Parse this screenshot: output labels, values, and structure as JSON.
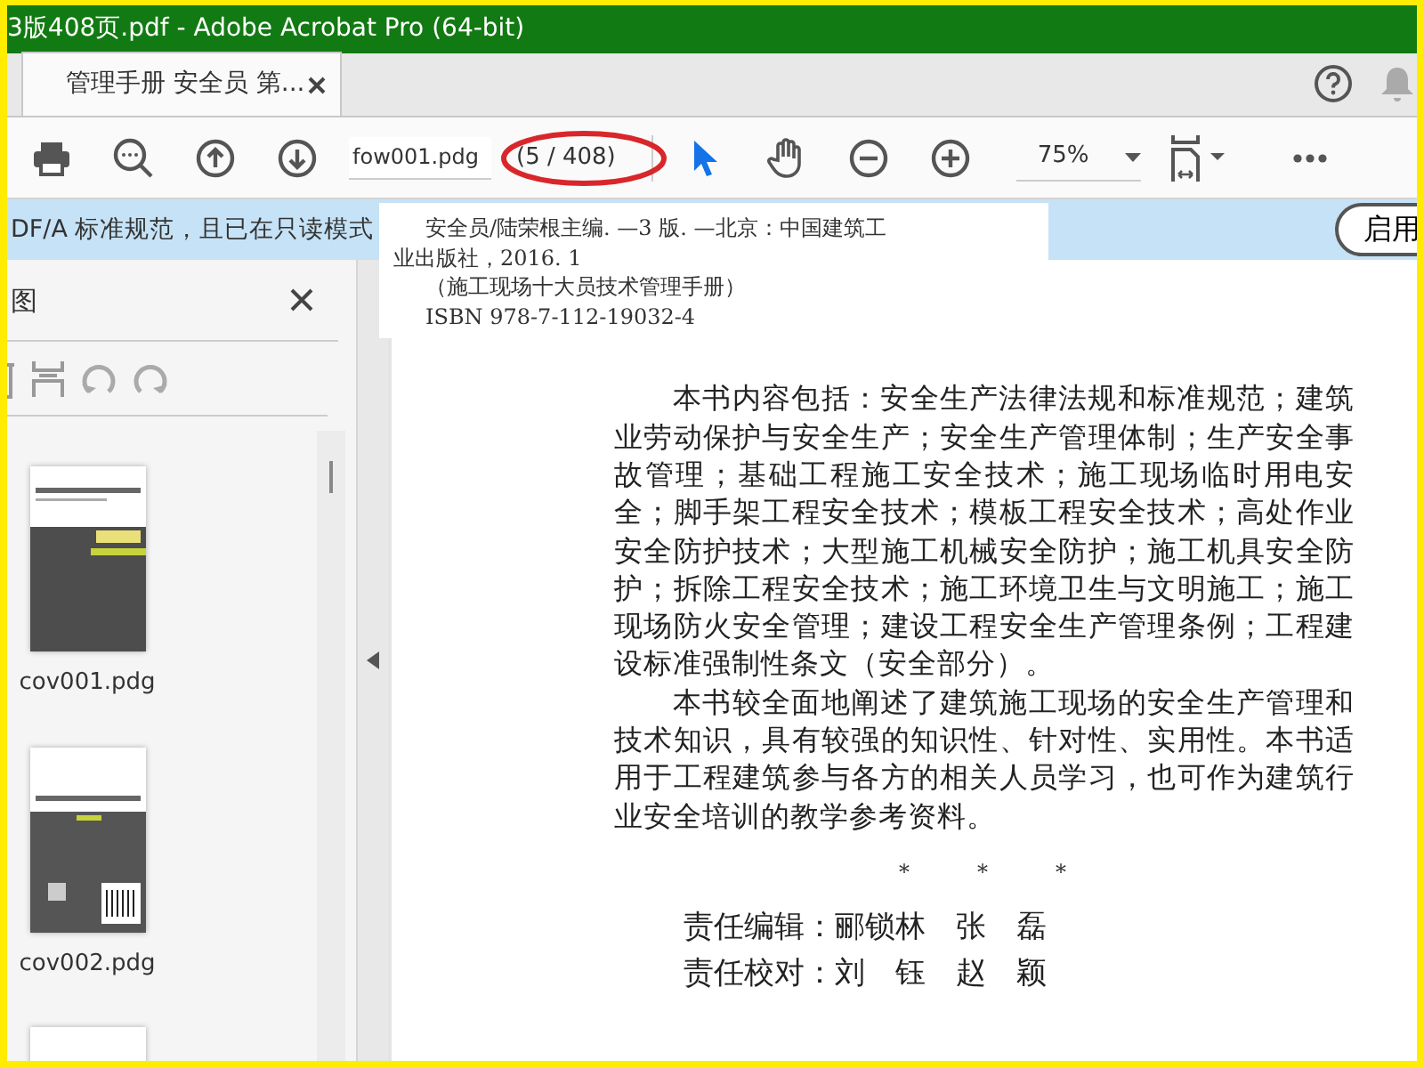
{
  "window": {
    "title": "3版408页.pdf - Adobe Acrobat Pro (64-bit)"
  },
  "tab": {
    "label": "管理手册 安全员 第..."
  },
  "toolbar": {
    "page_field": "fow001.pdg",
    "page_count": "(5 / 408)",
    "zoom": "75%",
    "tools": [
      {
        "kind": "select",
        "selected": true
      },
      {
        "kind": "hand",
        "selected": false
      }
    ]
  },
  "info_bar": {
    "message": "DF/A 标准规范，且已在只读模式",
    "button": "启用"
  },
  "sidebar": {
    "title": "图",
    "thumbnails": [
      {
        "kind": "cover",
        "label": "cov001.pdg"
      },
      {
        "kind": "back",
        "label": "cov002.pdg"
      },
      {
        "kind": "blank"
      }
    ]
  },
  "document": {
    "catalog": [
      "安全员/陆荣根主编. —3 版. —北京：中国建筑工",
      "业出版社，2016. 1",
      "（施工现场十大员技术管理手册）",
      "ISBN 978-7-112-19032-4"
    ],
    "paragraphs": [
      "本书内容包括：安全生产法律法规和标准规范；建筑业劳动保护与安全生产；安全生产管理体制；生产安全事故管理；基础工程施工安全技术；施工现场临时用电安全；脚手架工程安全技术；模板工程安全技术；高处作业安全防护技术；大型施工机械安全防护；施工机具安全防护；拆除工程安全技术；施工环境卫生与文明施工；施工现场防火安全管理；建设工程安全生产管理条例；工程建设标准强制性条文（安全部分）。",
      "本书较全面地阐述了建筑施工现场的安全生产管理和技术知识，具有较强的知识性、针对性、实用性。本书适用于工程建筑参与各方的相关人员学习，也可作为建筑行业安全培训的教学参考资料。"
    ],
    "separator": [
      "*",
      "*",
      "*"
    ],
    "credits": [
      "责任编辑：郦锁林　张　磊",
      "责任校对：刘　钰　赵　颖"
    ]
  }
}
